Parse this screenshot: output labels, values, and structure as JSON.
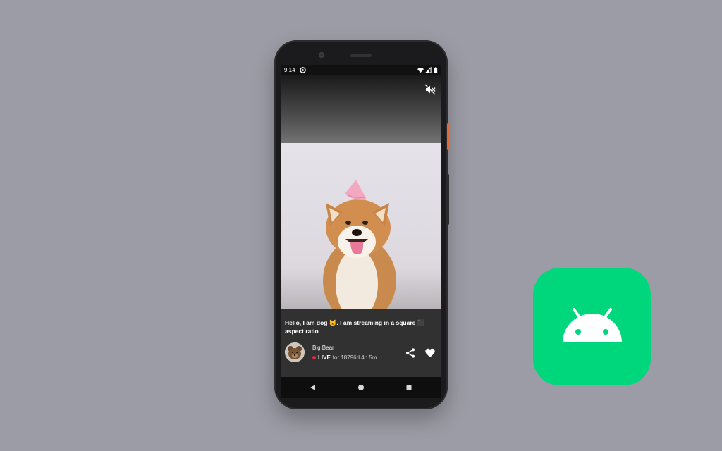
{
  "status_bar": {
    "time": "9:14",
    "sync_icon": "sync-icon",
    "wifi_icon": "wifi-icon",
    "signal_icon": "cellular-signal-icon",
    "battery_icon": "battery-icon"
  },
  "player": {
    "mute_icon": "volume-off-icon"
  },
  "stream": {
    "caption": "Hello, I am dog 🐱. I am streaming in a square ⬛ aspect ratio",
    "streamer_name": "Big Bear",
    "live_label": "LIVE",
    "duration_text": "for 18796d 4h 5m",
    "share_icon": "share-icon",
    "like_icon": "heart-icon"
  },
  "nav_bar": {
    "back_icon": "triangle-back-icon",
    "home_icon": "circle-home-icon",
    "recents_icon": "square-recents-icon"
  },
  "colors": {
    "background": "#9c9ca6",
    "live_dot": "#e02a44",
    "android_green": "#00d67c"
  },
  "app_icon": {
    "icon": "android-robot-icon"
  }
}
